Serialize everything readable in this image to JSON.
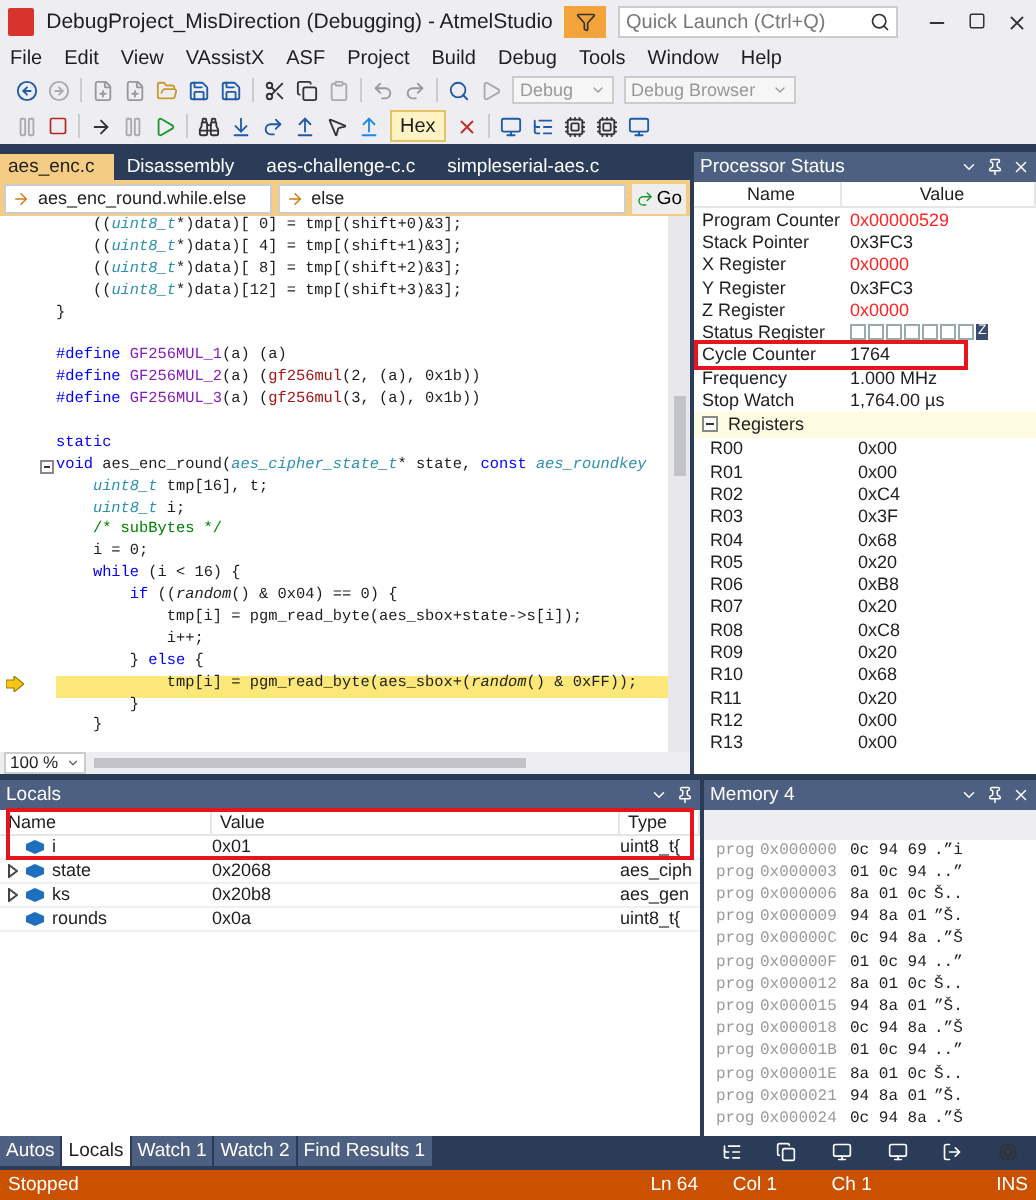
{
  "window": {
    "title": "DebugProject_MisDirection (Debugging) - AtmelStudio",
    "quick_launch": {
      "placeholder": "Quick Launch (Ctrl+Q)"
    }
  },
  "menu": [
    "File",
    "Edit",
    "View",
    "VAssistX",
    "ASF",
    "Project",
    "Build",
    "Debug",
    "Tools",
    "Window",
    "Help"
  ],
  "toolbar": {
    "configuration": "Debug",
    "browser": "Debug Browser",
    "hex": {
      "label": "Hex",
      "selected": true
    }
  },
  "editor": {
    "tabs": [
      {
        "label": "aes_enc.c",
        "selected": true
      },
      {
        "label": "Disassembly",
        "selected": false
      },
      {
        "label": "aes-challenge-c.c",
        "selected": false
      },
      {
        "label": "simpleserial-aes.c",
        "selected": false
      }
    ],
    "scope": "aes_enc_round.while.else",
    "member": "else",
    "go": "Go",
    "zoom": "100 %",
    "lines": [
      {
        "kind": "code",
        "segments": [
          {
            "kind": "plain",
            "text": "    (("
          },
          {
            "kind": "type",
            "text": "uint8_t"
          },
          {
            "kind": "plain",
            "text": "*)data)[ 0] = tmp[(shift+0)&3];"
          }
        ]
      },
      {
        "kind": "code",
        "segments": [
          {
            "kind": "plain",
            "text": "    (("
          },
          {
            "kind": "type",
            "text": "uint8_t"
          },
          {
            "kind": "plain",
            "text": "*)data)[ 4] = tmp[(shift+1)&3];"
          }
        ]
      },
      {
        "kind": "code",
        "segments": [
          {
            "kind": "plain",
            "text": "    (("
          },
          {
            "kind": "type",
            "text": "uint8_t"
          },
          {
            "kind": "plain",
            "text": "*)data)[ 8] = tmp[(shift+2)&3];"
          }
        ]
      },
      {
        "kind": "code",
        "segments": [
          {
            "kind": "plain",
            "text": "    (("
          },
          {
            "kind": "type",
            "text": "uint8_t"
          },
          {
            "kind": "plain",
            "text": "*)data)[12] = tmp[(shift+3)&3];"
          }
        ]
      },
      {
        "kind": "code",
        "segments": [
          {
            "kind": "plain",
            "text": "}"
          }
        ]
      },
      {
        "kind": "blank"
      },
      {
        "kind": "code",
        "segments": [
          {
            "kind": "keyword",
            "text": "#define "
          },
          {
            "kind": "macro",
            "text": "GF256MUL_1"
          },
          {
            "kind": "plain",
            "text": "(a) (a)"
          }
        ]
      },
      {
        "kind": "code",
        "segments": [
          {
            "kind": "keyword",
            "text": "#define "
          },
          {
            "kind": "macro",
            "text": "GF256MUL_2"
          },
          {
            "kind": "plain",
            "text": "(a) ("
          },
          {
            "kind": "function",
            "text": "gf256mul"
          },
          {
            "kind": "plain",
            "text": "(2, (a), 0x1b))"
          }
        ]
      },
      {
        "kind": "code",
        "segments": [
          {
            "kind": "keyword",
            "text": "#define "
          },
          {
            "kind": "macro",
            "text": "GF256MUL_3"
          },
          {
            "kind": "plain",
            "text": "(a) ("
          },
          {
            "kind": "function",
            "text": "gf256mul"
          },
          {
            "kind": "plain",
            "text": "(3, (a), 0x1b))"
          }
        ]
      },
      {
        "kind": "blank"
      },
      {
        "kind": "code",
        "segments": [
          {
            "kind": "keyword",
            "text": "static"
          }
        ]
      },
      {
        "kind": "code",
        "segments": [
          {
            "kind": "keyword",
            "text": "void "
          },
          {
            "kind": "plain",
            "text": "aes_enc_round("
          },
          {
            "kind": "type",
            "text": "aes_cipher_state_t"
          },
          {
            "kind": "plain",
            "text": "* state, "
          },
          {
            "kind": "keyword",
            "text": "const "
          },
          {
            "kind": "type",
            "text": "aes_roundkey"
          }
        ]
      },
      {
        "kind": "code",
        "segments": [
          {
            "kind": "type",
            "text": "    uint8_t "
          },
          {
            "kind": "plain",
            "text": "tmp[16], t;"
          }
        ]
      },
      {
        "kind": "code",
        "segments": [
          {
            "kind": "type",
            "text": "    uint8_t "
          },
          {
            "kind": "plain",
            "text": "i;"
          }
        ]
      },
      {
        "kind": "code",
        "segments": [
          {
            "kind": "comment",
            "text": "    /* subBytes */"
          }
        ]
      },
      {
        "kind": "code",
        "segments": [
          {
            "kind": "plain",
            "text": "    i = 0;"
          }
        ]
      },
      {
        "kind": "code",
        "segments": [
          {
            "kind": "keyword",
            "text": "    while "
          },
          {
            "kind": "plain",
            "text": "(i < 16) {"
          }
        ]
      },
      {
        "kind": "code",
        "segments": [
          {
            "kind": "keyword",
            "text": "        if "
          },
          {
            "kind": "plain",
            "text": "(("
          },
          {
            "kind": "italic",
            "text": "random"
          },
          {
            "kind": "plain",
            "text": "() & 0x04) == 0) {"
          }
        ]
      },
      {
        "kind": "code",
        "segments": [
          {
            "kind": "plain",
            "text": "            tmp[i] = pgm_read_byte(aes_sbox+state->s[i]);"
          }
        ]
      },
      {
        "kind": "code",
        "segments": [
          {
            "kind": "plain",
            "text": "            i++;"
          }
        ]
      },
      {
        "kind": "code",
        "segments": [
          {
            "kind": "plain",
            "text": "        } "
          },
          {
            "kind": "keyword",
            "text": "else "
          },
          {
            "kind": "plain",
            "text": "{"
          }
        ]
      },
      {
        "kind": "current",
        "segments": [
          {
            "kind": "plain",
            "text": "            tmp[i] = pgm_read_byte(aes_sbox+("
          },
          {
            "kind": "italic",
            "text": "random"
          },
          {
            "kind": "plain",
            "text": "() & 0xFF));"
          }
        ]
      },
      {
        "kind": "code",
        "segments": [
          {
            "kind": "plain",
            "text": "        }"
          }
        ]
      },
      {
        "kind": "code",
        "segments": [
          {
            "kind": "plain",
            "text": "    }"
          }
        ]
      }
    ]
  },
  "processor_status": {
    "title": "Processor Status",
    "columns": [
      "Name",
      "Value"
    ],
    "rows": [
      {
        "kind": "value",
        "name": "Program Counter",
        "value": "0x00000529",
        "changed": true
      },
      {
        "kind": "value",
        "name": "Stack Pointer",
        "value": "0x3FC3",
        "changed": false
      },
      {
        "kind": "value",
        "name": "X Register",
        "value": "0x0000",
        "changed": true
      },
      {
        "kind": "value",
        "name": "Y Register",
        "value": "0x3FC3",
        "changed": false
      },
      {
        "kind": "value",
        "name": "Z Register",
        "value": "0x0000",
        "changed": true
      },
      {
        "kind": "flags",
        "name": "Status Register",
        "flag": "Z"
      },
      {
        "kind": "value",
        "name": "Cycle Counter",
        "value": "1764",
        "changed": false
      },
      {
        "kind": "value",
        "name": "Frequency",
        "value": "1.000 MHz",
        "changed": false
      },
      {
        "kind": "value",
        "name": "Stop Watch",
        "value": "1,764.00 µs",
        "changed": false
      }
    ],
    "group": {
      "label": "Registers",
      "expanded": true
    },
    "registers": [
      [
        "R00",
        "0x00"
      ],
      [
        "R01",
        "0x00"
      ],
      [
        "R02",
        "0xC4"
      ],
      [
        "R03",
        "0x3F"
      ],
      [
        "R04",
        "0x68"
      ],
      [
        "R05",
        "0x20"
      ],
      [
        "R06",
        "0xB8"
      ],
      [
        "R07",
        "0x20"
      ],
      [
        "R08",
        "0xC8"
      ],
      [
        "R09",
        "0x20"
      ],
      [
        "R10",
        "0x68"
      ],
      [
        "R11",
        "0x20"
      ],
      [
        "R12",
        "0x00"
      ],
      [
        "R13",
        "0x00"
      ]
    ]
  },
  "locals": {
    "title": "Locals",
    "columns": [
      "Name",
      "Value",
      "Type"
    ],
    "rows": [
      {
        "name": "i",
        "value": "0x01",
        "type": "uint8_t{",
        "expandable": false
      },
      {
        "name": "state",
        "value": "0x2068",
        "type": "aes_ciph",
        "expandable": true
      },
      {
        "name": "ks",
        "value": "0x20b8",
        "type": "aes_gen",
        "expandable": true
      },
      {
        "name": "rounds",
        "value": "0x0a",
        "type": "uint8_t{",
        "expandable": false
      }
    ]
  },
  "memory": {
    "title": "Memory 4",
    "rows": [
      [
        "prog",
        "0x000000",
        "0c 94 69",
        ".”i"
      ],
      [
        "prog",
        "0x000003",
        "01 0c 94",
        "..”"
      ],
      [
        "prog",
        "0x000006",
        "8a 01 0c",
        "Š.."
      ],
      [
        "prog",
        "0x000009",
        "94 8a 01",
        "”Š."
      ],
      [
        "prog",
        "0x00000C",
        "0c 94 8a",
        ".”Š"
      ],
      [
        "prog",
        "0x00000F",
        "01 0c 94",
        "..”"
      ],
      [
        "prog",
        "0x000012",
        "8a 01 0c",
        "Š.."
      ],
      [
        "prog",
        "0x000015",
        "94 8a 01",
        "”Š."
      ],
      [
        "prog",
        "0x000018",
        "0c 94 8a",
        ".”Š"
      ],
      [
        "prog",
        "0x00001B",
        "01 0c 94",
        "..”"
      ],
      [
        "prog",
        "0x00001E",
        "8a 01 0c",
        "Š.."
      ],
      [
        "prog",
        "0x000021",
        "94 8a 01",
        "”Š."
      ],
      [
        "prog",
        "0x000024",
        "0c 94 8a",
        ".”Š"
      ]
    ]
  },
  "bottom_tabs": [
    {
      "label": "Autos",
      "selected": false
    },
    {
      "label": "Locals",
      "selected": true
    },
    {
      "label": "Watch 1",
      "selected": false
    },
    {
      "label": "Watch 2",
      "selected": false
    },
    {
      "label": "Find Results 1",
      "selected": false
    }
  ],
  "status_bar": {
    "state": "Stopped",
    "line": "Ln 64",
    "column": "Col 1",
    "char": "Ch 1",
    "mode": "INS"
  }
}
